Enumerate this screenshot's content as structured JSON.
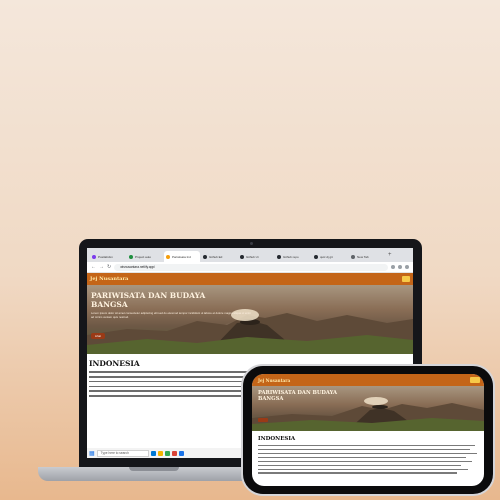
{
  "browser": {
    "tabs": [
      {
        "label": "Postlabdxn",
        "color": "#7c3aed",
        "active": false
      },
      {
        "label": "Project auto",
        "color": "#1e8e3e",
        "active": false
      },
      {
        "label": "Pariwisata Ind",
        "color": "#f59e0b",
        "active": true
      },
      {
        "label": "Github Ed",
        "color": "#24292f",
        "active": false
      },
      {
        "label": "Github Ui",
        "color": "#24292f",
        "active": false
      },
      {
        "label": "Github repo",
        "color": "#24292f",
        "active": false
      },
      {
        "label": "quiz.dj git",
        "color": "#24292f",
        "active": false
      },
      {
        "label": "New Tab",
        "color": "#5f6368",
        "active": false
      }
    ],
    "url": "wisnusantara.netlify.app/"
  },
  "site": {
    "brand": "Jej Nusantara",
    "hero_title": "PARIWISATA DAN BUDAYA BANGSA",
    "hero_desc": "Lorem ipsum dolor sit amet consectetur adipiscing elit sed do eiusmod tempor incididunt ut labore et dolore magna aliqua ut enim ad minim veniam quis nostrud.",
    "hero_button": "Lihat",
    "section_title": "INDONESIA"
  },
  "taskbar": {
    "search_placeholder": "Type here to search"
  },
  "phone": {
    "brand": "Jej Nusantara",
    "hero_title": "PARIWISATA DAN BUDAYA BANGSA",
    "section_title": "INDONESIA"
  }
}
